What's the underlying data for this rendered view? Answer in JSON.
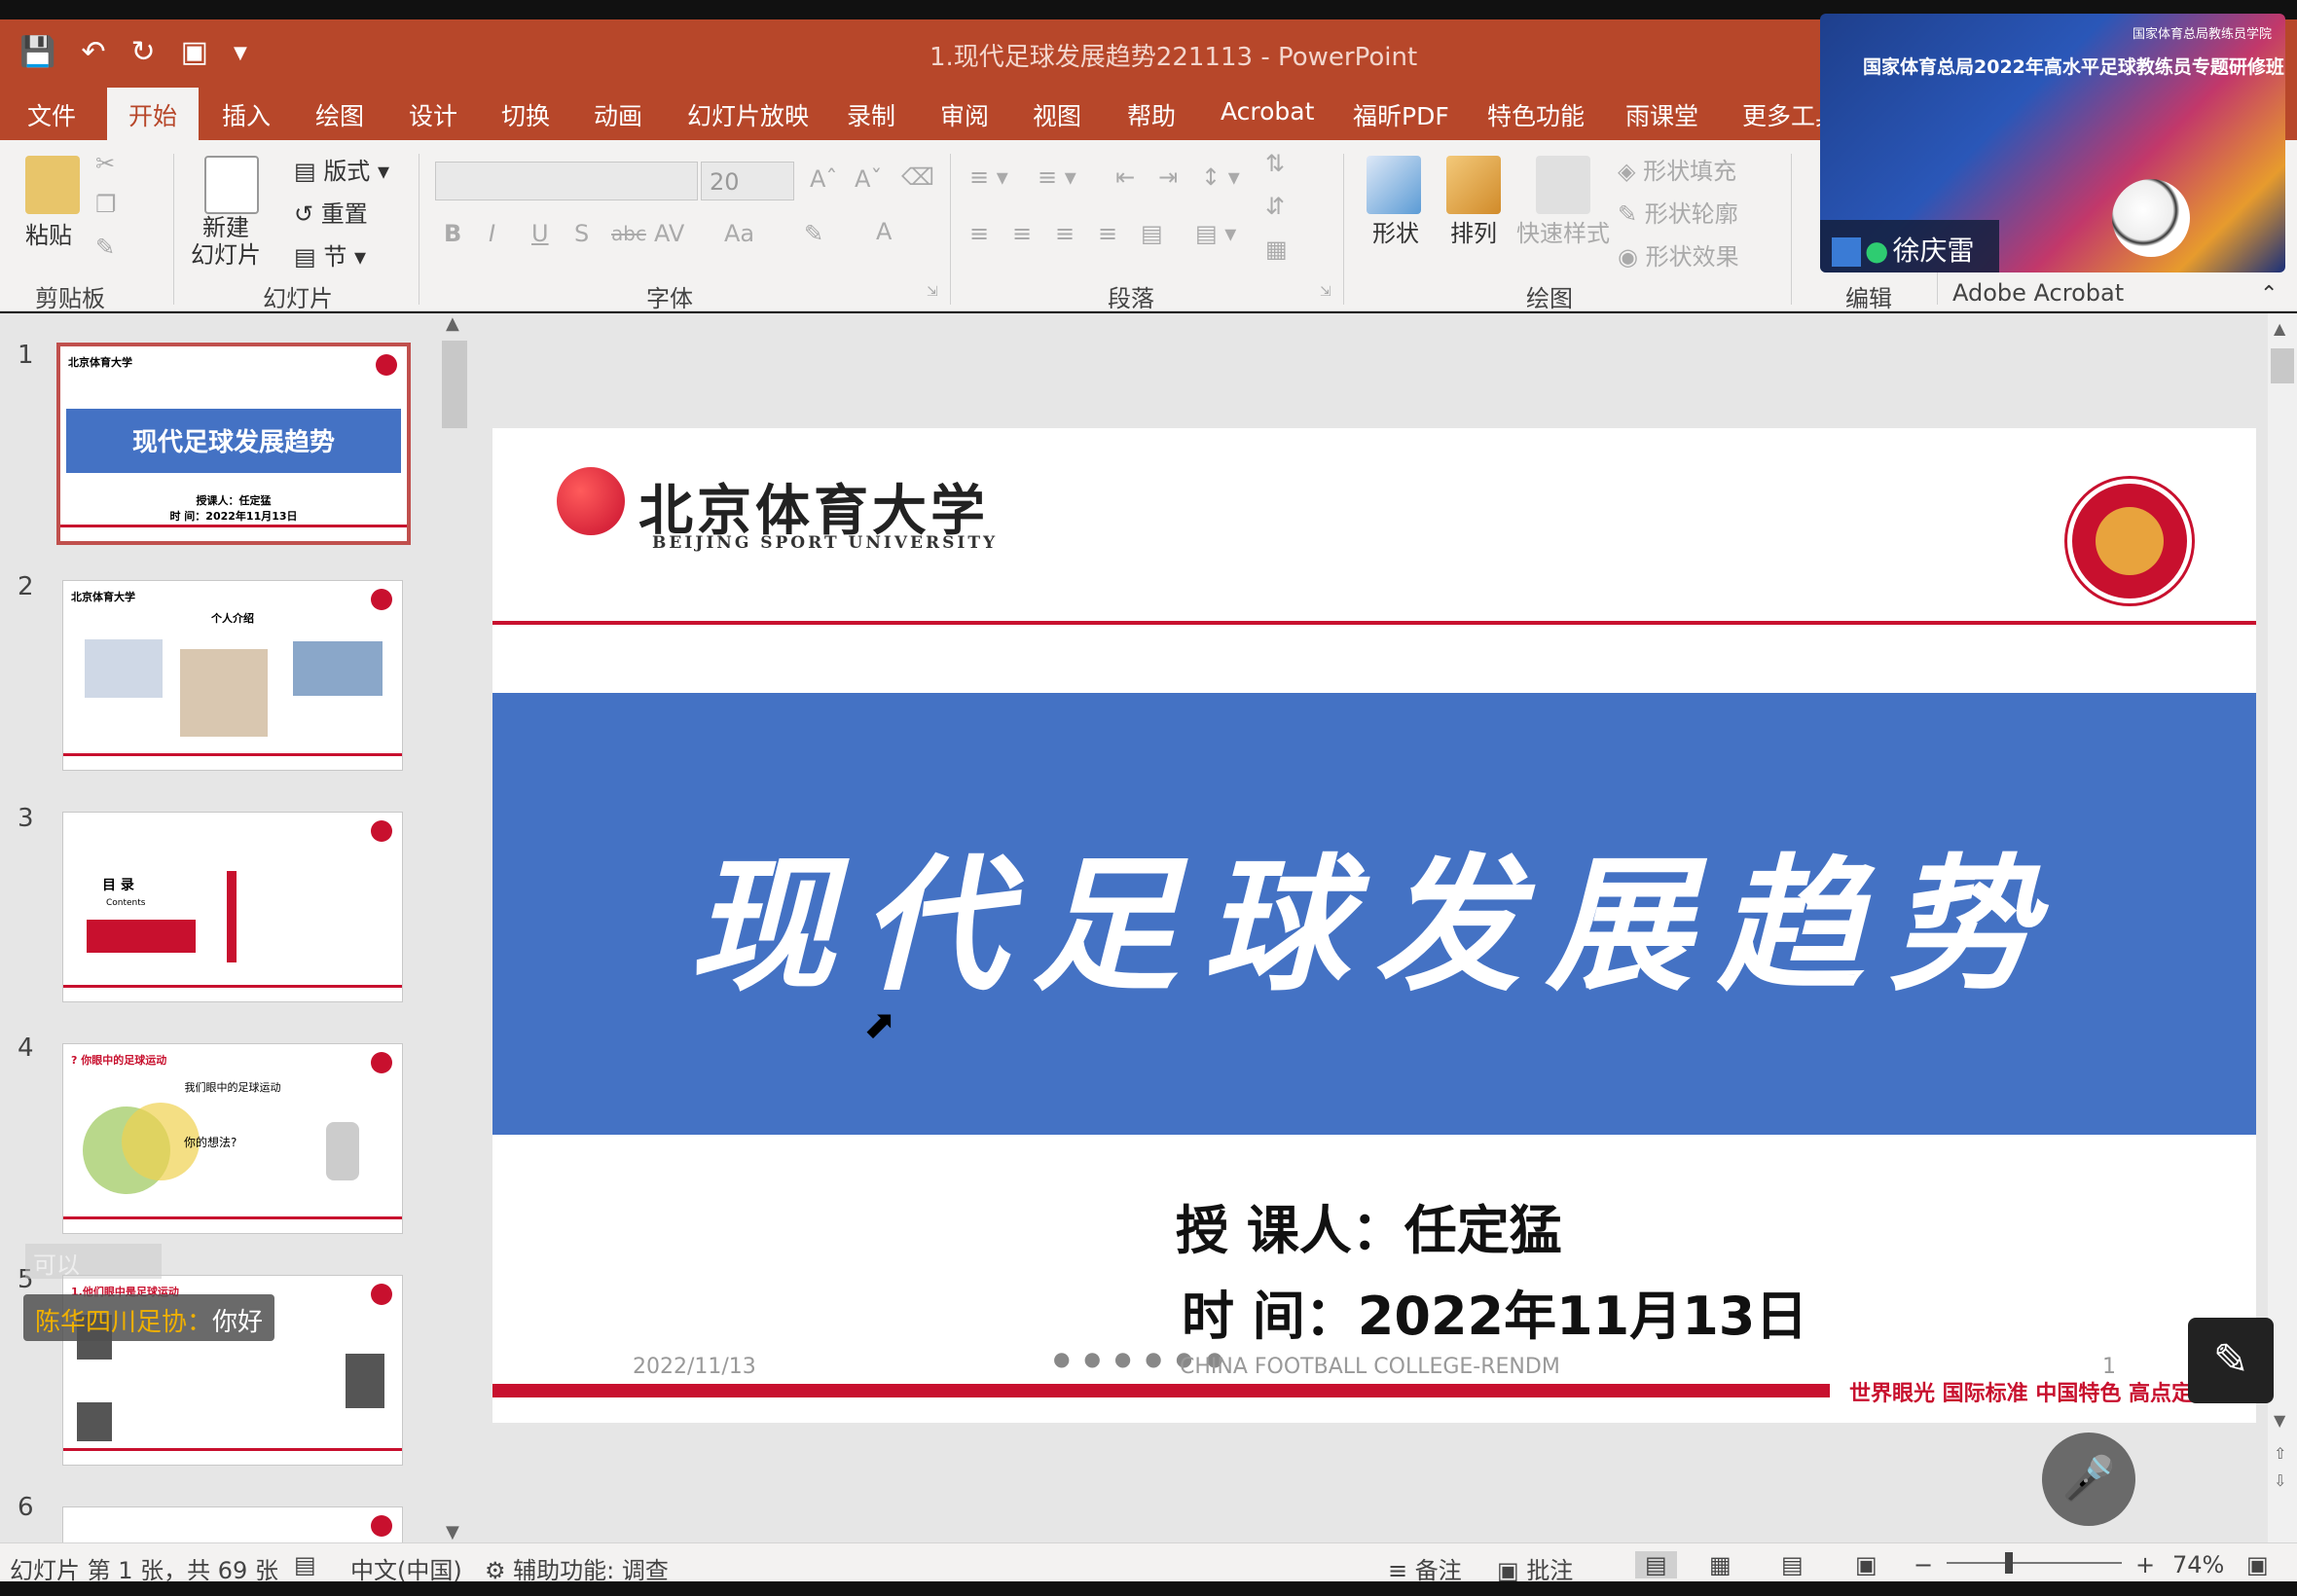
{
  "window": {
    "title": "1.现代足球发展趋势221113  -  PowerPoint",
    "qat_icons": [
      "save-icon",
      "undo-icon",
      "redo-icon",
      "present-icon",
      "customize-icon"
    ]
  },
  "menu": {
    "items": [
      "文件",
      "开始",
      "插入",
      "绘图",
      "设计",
      "切换",
      "动画",
      "幻灯片放映",
      "录制",
      "审阅",
      "视图",
      "帮助",
      "Acrobat",
      "福昕PDF",
      "特色功能",
      "雨课堂",
      "更多工具"
    ],
    "active": "开始"
  },
  "ribbon": {
    "clipboard": {
      "paste": "粘贴",
      "label": "剪贴板"
    },
    "slides": {
      "new_slide": "新建\n幻灯片",
      "layout": "版式",
      "reset": "重置",
      "section": "节",
      "label": "幻灯片"
    },
    "font": {
      "size": "20",
      "label": "字体",
      "bold": "B",
      "italic": "I",
      "underline": "U",
      "shadow": "S",
      "strike": "abc",
      "spacing": "AV",
      "case": "Aa",
      "color": "A"
    },
    "paragraph": {
      "label": "段落"
    },
    "drawing": {
      "shapes": "形状",
      "arrange": "排列",
      "quick_styles": "快速样式",
      "fill": "形状填充",
      "outline": "形状轮廓",
      "effects": "形状效果",
      "label": "绘图"
    },
    "editing": {
      "label": "编辑"
    },
    "acrobat": {
      "label": "Adobe Acrobat"
    }
  },
  "video": {
    "banner": "国家体育总局2022年高水平足球教练员专题研修班",
    "logo_text": "国家体育总局教练员学院",
    "participant": "徐庆雷"
  },
  "thumbnails": [
    {
      "num": "1",
      "title": "现代足球发展趋势",
      "sub1": "授课人：任定猛",
      "sub2": "时  间：2022年11月13日"
    },
    {
      "num": "2",
      "heading": "个人介绍"
    },
    {
      "num": "3",
      "heading": "目 录",
      "sub": "Contents"
    },
    {
      "num": "4",
      "heading": "? 你眼中的足球运动",
      "sub": "我们眼中的足球运动",
      "bubble": "你的想法?"
    },
    {
      "num": "5",
      "heading": "1.他们眼中是足球运动"
    },
    {
      "num": "6"
    }
  ],
  "slide": {
    "university_cn": "北京体育大学",
    "university_en": "BEIJING SPORT UNIVERSITY",
    "title": "现代足球发展趋势",
    "lecturer": "授 课人：任定猛",
    "date": "时    间：2022年11月13日",
    "footer_date": "2022/11/13",
    "footer_center": "CHINA FOOTBALL COLLEGE-RENDM",
    "footer_num": "1",
    "slogan": "世界眼光 国际标准 中国特色 高点定位"
  },
  "chat": {
    "faded": "可以",
    "sender": "陈华四川足协：",
    "message": "你好"
  },
  "status": {
    "slide_info": "幻灯片 第 1 张，共 69 张",
    "language": "中文(中国)",
    "accessibility": "辅助功能: 调查",
    "notes": "备注",
    "comments": "批注",
    "zoom": "74%"
  }
}
